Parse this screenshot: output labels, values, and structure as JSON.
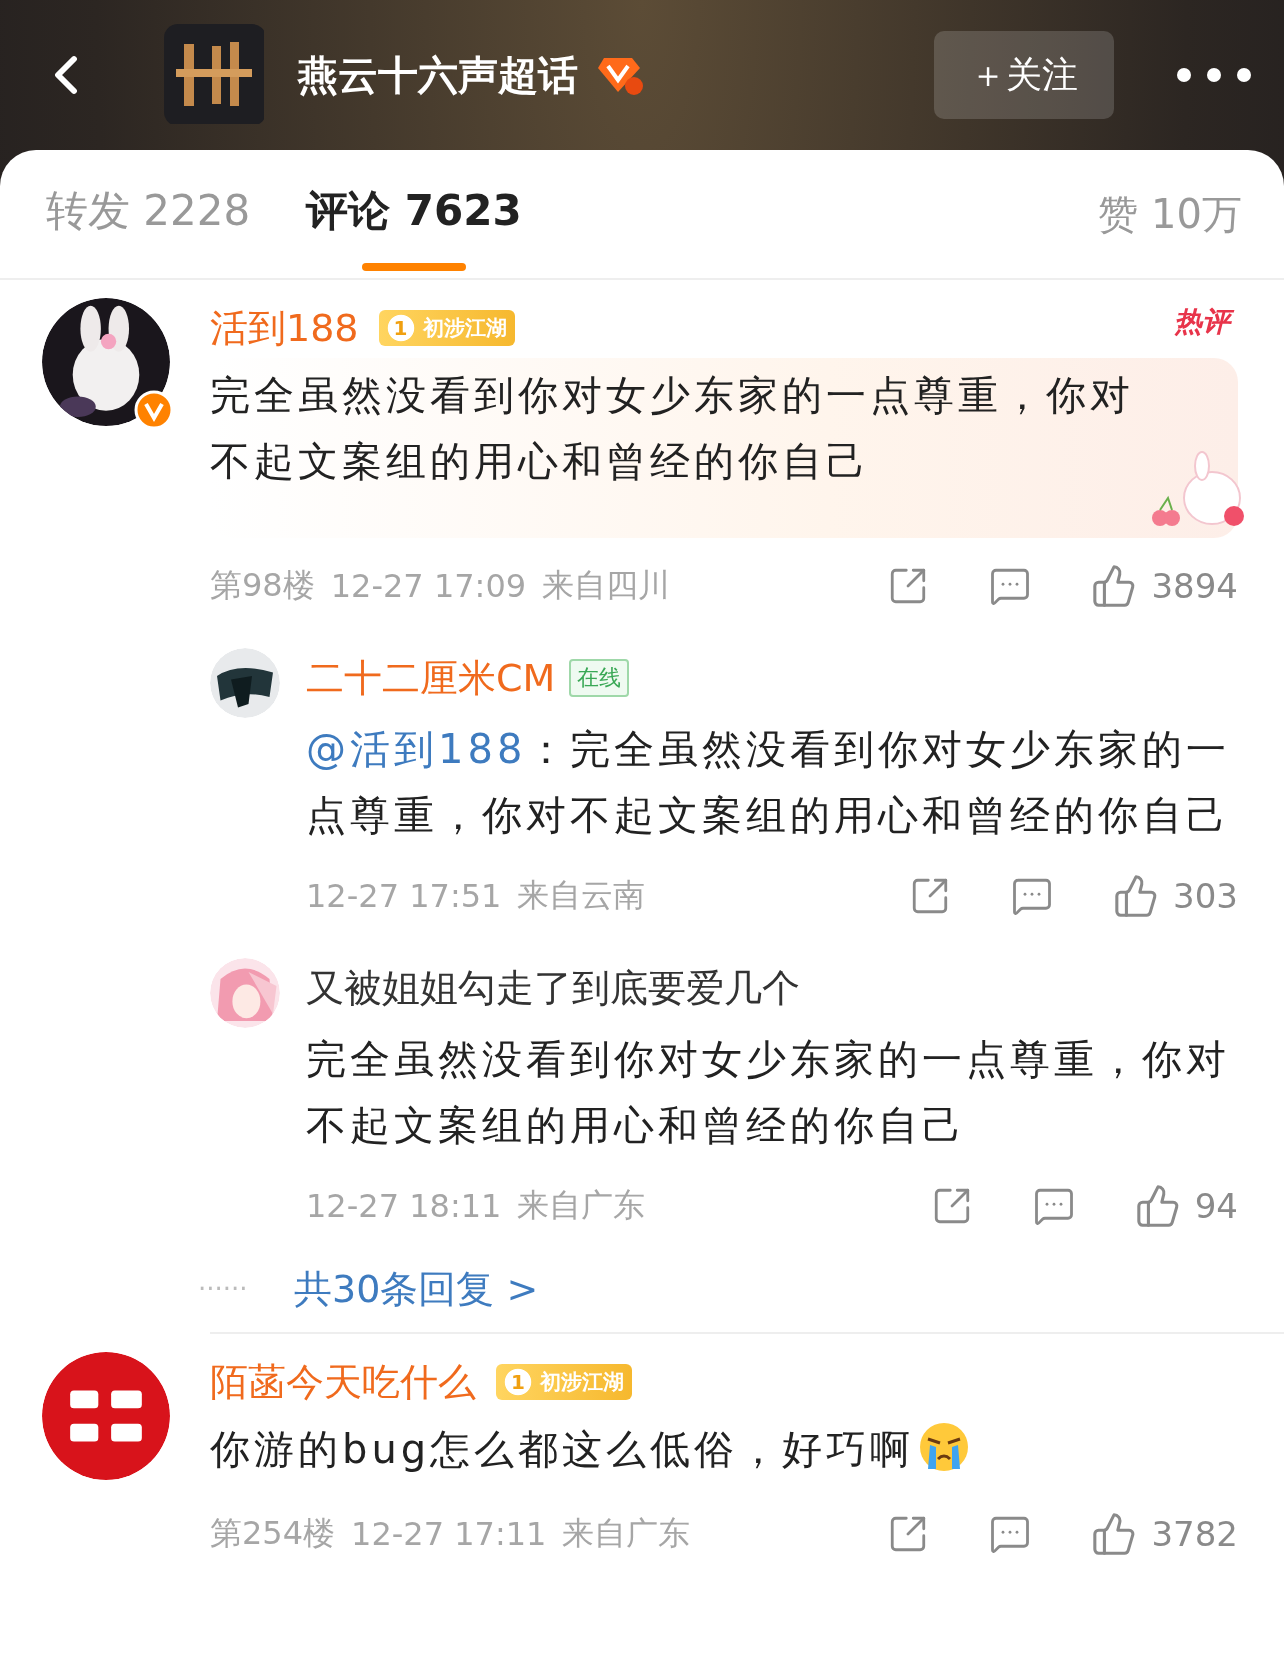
{
  "header": {
    "title": "燕云十六声超话",
    "follow_button": "＋关注"
  },
  "tabs": [
    {
      "label": "转发 2228",
      "selected": false
    },
    {
      "label": "评论 7623",
      "selected": true
    }
  ],
  "likes_total": "赞 10万",
  "comments": [
    {
      "name": "活到188",
      "badge": {
        "level": "1",
        "label": "初涉江湖"
      },
      "hot_label": "热评",
      "verified": true,
      "highlighted": true,
      "text": "完全虽然没看到你对女少东家的一点尊重，你对不起文案组的用心和曾经的你自己",
      "floor": "第98楼",
      "time": "12-27 17:09",
      "location": "来自四川",
      "likes": "3894",
      "replies": [
        {
          "name": "二十二厘米CM",
          "name_highlighted": true,
          "status": "在线",
          "mention": "@活到188",
          "text": "：完全虽然没看到你对女少东家的一点尊重，你对不起文案组的用心和曾经的你自己",
          "time": "12-27 17:51",
          "location": "来自云南",
          "likes": "303"
        },
        {
          "name": "又被姐姐勾走了到底要爱几个",
          "name_highlighted": false,
          "text": "完全虽然没看到你对女少东家的一点尊重，你对不起文案组的用心和曾经的你自己",
          "time": "12-27 18:11",
          "location": "来自广东",
          "likes": "94"
        }
      ],
      "more_replies": {
        "dots": "······",
        "label": "共30条回复 >"
      }
    },
    {
      "name": "陌菡今天吃什么",
      "badge": {
        "level": "1",
        "label": "初涉江湖"
      },
      "verified": false,
      "highlighted": false,
      "text": "你游的bug怎么都这么低俗，好巧啊",
      "emoji": true,
      "floor": "第254楼",
      "time": "12-27 17:11",
      "location": "来自广东",
      "likes": "3782"
    }
  ]
}
